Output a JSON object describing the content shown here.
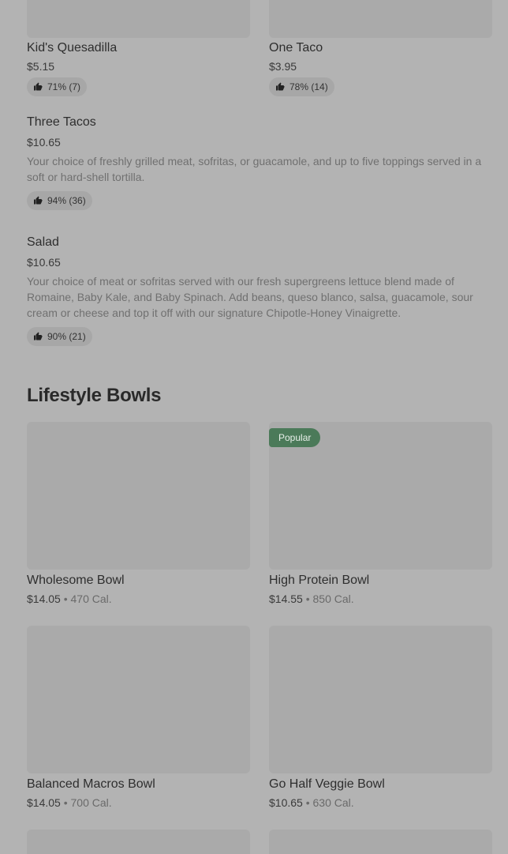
{
  "items_top": [
    {
      "name": "Kid's Quesadilla",
      "price": "$5.15",
      "rating": "71% (7)"
    },
    {
      "name": "One Taco",
      "price": "$3.95",
      "rating": "78% (14)"
    }
  ],
  "list_items": [
    {
      "name": "Three Tacos",
      "price": "$10.65",
      "description": "Your choice of freshly grilled meat, sofritas, or guacamole, and up to five toppings served in a soft or hard-shell tortilla.",
      "rating": "94% (36)"
    },
    {
      "name": "Salad",
      "price": "$10.65",
      "description": "Your choice of meat or sofritas served with our fresh supergreens lettuce blend made of Romaine, Baby Kale, and Baby Spinach. Add beans, queso blanco, salsa, guacamole, sour cream or cheese and top it off with our signature Chipotle-Honey Vinaigrette.",
      "rating": "90% (21)"
    }
  ],
  "section": {
    "title": "Lifestyle Bowls",
    "badge": "Popular",
    "separator": "•",
    "items": [
      {
        "name": "Wholesome Bowl",
        "price": "$14.05",
        "calories": "470 Cal."
      },
      {
        "name": "High Protein Bowl",
        "price": "$14.55",
        "calories": "850 Cal."
      },
      {
        "name": "Balanced Macros Bowl",
        "price": "$14.05",
        "calories": "700 Cal."
      },
      {
        "name": "Go Half Veggie Bowl",
        "price": "$10.65",
        "calories": "630 Cal."
      }
    ]
  },
  "icons": {
    "rating": "thumbs-up-icon"
  }
}
